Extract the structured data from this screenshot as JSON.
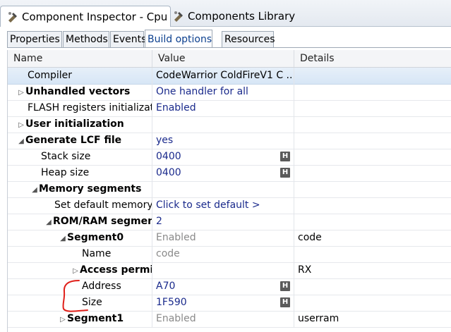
{
  "view_tabs": [
    {
      "label": "Component Inspector - Cpu",
      "close": "⊠"
    },
    {
      "label": "Components Library"
    }
  ],
  "page_tabs": [
    "Properties",
    "Methods",
    "Events",
    "Build options",
    "Resources"
  ],
  "active_page_tab": "Build options",
  "columns": {
    "name": "Name",
    "value": "Value",
    "details": "Details"
  },
  "rows": [
    {
      "name": "Compiler",
      "value": "CodeWarrior ColdFireV1 C ...",
      "details": ""
    },
    {
      "name": "Unhandled vectors",
      "value": "One handler for all",
      "details": ""
    },
    {
      "name": "FLASH registers initialization",
      "value": "Enabled",
      "details": ""
    },
    {
      "name": "User initialization",
      "value": "",
      "details": ""
    },
    {
      "name": "Generate LCF file",
      "value": "yes",
      "details": ""
    },
    {
      "name": "Stack size",
      "value": "0400",
      "details": "",
      "badge": "H"
    },
    {
      "name": "Heap size",
      "value": "0400",
      "details": "",
      "badge": "H"
    },
    {
      "name": "Memory segments",
      "value": "",
      "details": ""
    },
    {
      "name": "Set default memory segments",
      "value": "Click to set default >",
      "details": ""
    },
    {
      "name": "ROM/RAM segments",
      "value": "2",
      "details": ""
    },
    {
      "name": "Segment0",
      "value": "Enabled",
      "details": "code"
    },
    {
      "name": "Name",
      "value": "code",
      "details": ""
    },
    {
      "name": "Access permissions",
      "value": "",
      "details": "RX"
    },
    {
      "name": "Address",
      "value": "A70",
      "details": "",
      "badge": "H"
    },
    {
      "name": "Size",
      "value": "1F590",
      "details": "",
      "badge": "H"
    },
    {
      "name": "Segment1",
      "value": "Enabled",
      "details": "userram"
    }
  ],
  "colors": {
    "value_text": "#1a2a8c",
    "disabled_text": "#8a8a8a",
    "annotation": "#e0201a",
    "selected_row": "#dbe8f7"
  }
}
